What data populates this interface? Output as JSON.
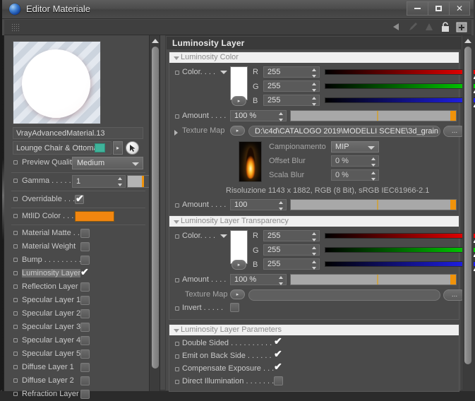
{
  "window": {
    "title": "Editor Materiale",
    "icon": "sphere-icon",
    "minimize_label": "minimize",
    "maximize_label": "maximize",
    "close_label": "✕"
  },
  "toolbar": {
    "icons": [
      "back-arrow-icon",
      "pencil-icon",
      "up-arrow-icon",
      "lock-icon",
      "plus-icon"
    ]
  },
  "left_panel": {
    "material_name": "VrayAdvancedMaterial.13",
    "object_name": "Lounge Chair & Ottoman",
    "swatch_color": "#3fb39a",
    "preview_quality": {
      "label": "Preview Quality",
      "value": "Medium"
    },
    "gamma": {
      "label": "Gamma . . . . . .",
      "value": "1"
    },
    "overridable": {
      "label": "Overridable . . .",
      "checked": true
    },
    "mtlid_color": {
      "label": "MtlID Color . . .",
      "color": "#f2860f"
    },
    "layers": [
      {
        "label": "Material Matte . .",
        "checked": false
      },
      {
        "label": "Material Weight",
        "checked": false
      },
      {
        "label": "Bump . . . . . . . . .",
        "checked": false
      },
      {
        "label": "Luminosity Layer",
        "checked": true,
        "selected": true
      },
      {
        "label": "Reflection Layer",
        "checked": false
      },
      {
        "label": "Specular Layer 1",
        "checked": false
      },
      {
        "label": "Specular Layer 2",
        "checked": false
      },
      {
        "label": "Specular Layer 3",
        "checked": false
      },
      {
        "label": "Specular Layer 4",
        "checked": false
      },
      {
        "label": "Specular Layer 5",
        "checked": false
      },
      {
        "label": "Diffuse Layer 1",
        "checked": false
      },
      {
        "label": "Diffuse Layer 2",
        "checked": false
      },
      {
        "label": "Refraction Layer",
        "checked": false
      }
    ]
  },
  "right_panel": {
    "header": "Luminosity Layer",
    "luminosity_color": {
      "title": "Luminosity Color",
      "color_label": "Color. . . .",
      "swatch": "#ffffff",
      "r_label": "R",
      "r_value": "255",
      "g_label": "G",
      "g_value": "255",
      "b_label": "B",
      "b_value": "255",
      "amount_label": "Amount . . . .",
      "amount_value": "100 %",
      "texture_map_label": "Texture Map",
      "texture_path": "D:\\c4d\\CATALOGO 2019\\MODELLI SCENE\\3d_grain",
      "browse_label": "...",
      "sampling_label": "Campionamento",
      "sampling_value": "MIP",
      "offset_blur_label": "Offset Blur",
      "offset_blur_value": "0 %",
      "scala_blur_label": "Scala Blur",
      "scala_blur_value": "0 %",
      "resolution_text": "Risoluzione 1143 x 1882, RGB (8 Bit), sRGB IEC61966-2.1",
      "tex_amount_label": "Amount . . . .",
      "tex_amount_value": "100"
    },
    "luminosity_transparency": {
      "title": "Luminosity Layer Transparency",
      "color_label": "Color. . . .",
      "swatch": "#ffffff",
      "r_label": "R",
      "r_value": "255",
      "g_label": "G",
      "g_value": "255",
      "b_label": "B",
      "b_value": "255",
      "amount_label": "Amount . . . .",
      "amount_value": "100 %",
      "texture_map_label": "Texture Map",
      "texture_path": "",
      "browse_label": "...",
      "invert_label": "Invert . . . . .",
      "invert_checked": false
    },
    "luminosity_parameters": {
      "title": "Luminosity Layer Parameters",
      "items": [
        {
          "label": "Double Sided . . . . . . . . . .",
          "checked": true
        },
        {
          "label": "Emit on Back Side . . . . . .",
          "checked": true
        },
        {
          "label": "Compensate Exposure . . .",
          "checked": true
        },
        {
          "label": "Direct Illumination . . . . . . .",
          "checked": false
        }
      ]
    }
  }
}
